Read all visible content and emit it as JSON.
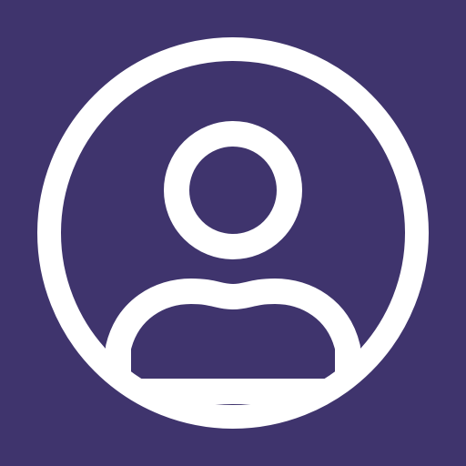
{
  "icon": {
    "name": "user-account-icon",
    "background_color": "#3f346d",
    "foreground_color": "#ffffff"
  }
}
